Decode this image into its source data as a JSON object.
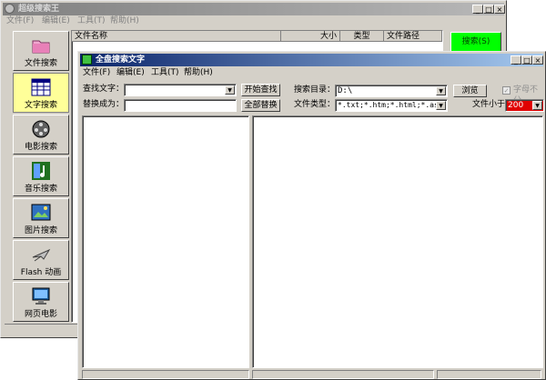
{
  "main_window": {
    "title": "超级搜索王",
    "menu": [
      "文件(F)",
      "编辑(E)",
      "工具(T)",
      "帮助(H)"
    ],
    "columns": [
      "文件名称",
      "大小",
      "类型",
      "文件路径"
    ],
    "search_button": "搜索(S)",
    "sidebar": [
      {
        "label": "文件搜索",
        "icon": "folder-icon"
      },
      {
        "label": "文字搜索",
        "icon": "text-grid-icon"
      },
      {
        "label": "电影搜索",
        "icon": "film-reel-icon"
      },
      {
        "label": "音乐搜索",
        "icon": "music-note-icon"
      },
      {
        "label": "图片搜索",
        "icon": "picture-icon"
      },
      {
        "label": "Flash 动画",
        "icon": "airplane-icon"
      },
      {
        "label": "网页电影",
        "icon": "monitor-icon"
      }
    ],
    "window_controls": [
      "_",
      "□",
      "×"
    ]
  },
  "dialog": {
    "title": "全盘搜索文字",
    "menu": [
      "文件(F)",
      "编辑(E)",
      "工具(T)",
      "帮助(H)"
    ],
    "find_label": "查找文字：",
    "find_value": "",
    "replace_label": "替换成为：",
    "replace_value": "",
    "start_button": "开始查找",
    "replace_all_button": "全部替换",
    "dir_label": "搜索目录：",
    "dir_value": "D:\\",
    "browse_button": "浏览",
    "type_label": "文件类型：",
    "type_value": "*.txt;*.htm;*.html;*.asp",
    "case_label": "字母不分",
    "size_label": "文件小于",
    "size_value": "200",
    "window_controls": [
      "_",
      "□",
      "×"
    ]
  },
  "colors": {
    "search_button_green": "#00ff00",
    "size_field_red": "#e00000",
    "active_title": "#0a246a",
    "inactive_title": "#808080"
  }
}
